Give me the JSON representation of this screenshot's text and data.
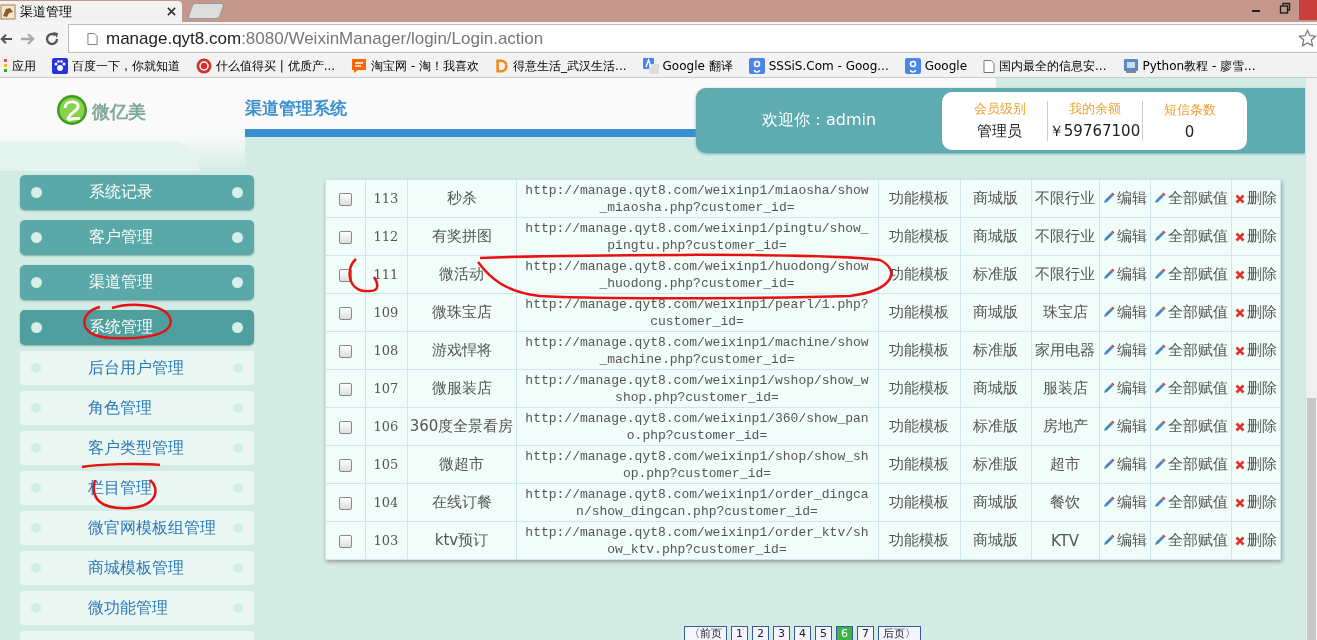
{
  "browser": {
    "tab_title": "渠道管理",
    "url_host": "manage.qyt8.com",
    "url_rest": ":8080/WeixinManager/login/Login.action",
    "bookmarks": [
      {
        "label": "应用",
        "kind": "apps"
      },
      {
        "label": "百度一下，你就知道",
        "kind": "paw"
      },
      {
        "label": "什么值得买 | 优质产...",
        "kind": "seal"
      },
      {
        "label": "淘宝网 - 淘！我喜欢",
        "kind": "taobao"
      },
      {
        "label": "得意生活_武汉生活...",
        "kind": "letter"
      },
      {
        "label": "Google 翻译",
        "kind": "translate"
      },
      {
        "label": "SSSiS.Com - Goog...",
        "kind": "google"
      },
      {
        "label": "Google",
        "kind": "google"
      },
      {
        "label": "国内最全的信息安...",
        "kind": "page"
      },
      {
        "label": "Python教程 - 廖雪...",
        "kind": "mac"
      }
    ]
  },
  "header": {
    "logo_text": "微亿美",
    "title": "渠道管理系统",
    "welcome": "欢迎你：admin",
    "stats": [
      {
        "label": "会员级别",
        "value": "管理员"
      },
      {
        "label": "我的余额",
        "value": "￥59767100"
      },
      {
        "label": "短信条数",
        "value": "0"
      }
    ]
  },
  "sidebar": {
    "items": [
      {
        "label": "系统记录"
      },
      {
        "label": "客户管理"
      },
      {
        "label": "渠道管理"
      },
      {
        "label": "系统管理",
        "children": [
          {
            "label": "后台用户管理"
          },
          {
            "label": "角色管理"
          },
          {
            "label": "客户类型管理"
          },
          {
            "label": "栏目管理"
          },
          {
            "label": "微官网模板组管理"
          },
          {
            "label": "商城模板管理"
          },
          {
            "label": "微功能管理"
          }
        ]
      }
    ]
  },
  "table": {
    "rows": [
      {
        "checked": false,
        "id": "113",
        "name": "秒杀",
        "url": "http://manage.qyt8.com/weixinp1/miaosha/show_miaosha.php?customer_id=",
        "type": "功能模板",
        "edition": "商城版",
        "industry": "不限行业",
        "edit": "编辑",
        "assign": "全部赋值",
        "delete": "删除"
      },
      {
        "checked": false,
        "id": "112",
        "name": "有奖拼图",
        "url": "http://manage.qyt8.com/weixinp1/pingtu/show_pingtu.php?customer_id=",
        "type": "功能模板",
        "edition": "商城版",
        "industry": "不限行业",
        "edit": "编辑",
        "assign": "全部赋值",
        "delete": "删除"
      },
      {
        "checked": false,
        "id": "111",
        "name": "微活动",
        "url": "http://manage.qyt8.com/weixinp1/huodong/show_huodong.php?customer_id=",
        "type": "功能模板",
        "edition": "标准版",
        "industry": "不限行业",
        "edit": "编辑",
        "assign": "全部赋值",
        "delete": "删除"
      },
      {
        "checked": false,
        "id": "109",
        "name": "微珠宝店",
        "url": "http://manage.qyt8.com/weixinp1/pearl/1.php?customer_id=",
        "type": "功能模板",
        "edition": "商城版",
        "industry": "珠宝店",
        "edit": "编辑",
        "assign": "全部赋值",
        "delete": "删除"
      },
      {
        "checked": false,
        "id": "108",
        "name": "游戏悍将",
        "url": "http://manage.qyt8.com/weixinp1/machine/show_machine.php?customer_id=",
        "type": "功能模板",
        "edition": "标准版",
        "industry": "家用电器",
        "edit": "编辑",
        "assign": "全部赋值",
        "delete": "删除"
      },
      {
        "checked": false,
        "id": "107",
        "name": "微服装店",
        "url": "http://manage.qyt8.com/weixinp1/wshop/show_wshop.php?customer_id=",
        "type": "功能模板",
        "edition": "商城版",
        "industry": "服装店",
        "edit": "编辑",
        "assign": "全部赋值",
        "delete": "删除"
      },
      {
        "checked": false,
        "id": "106",
        "name": "360度全景看房",
        "url": "http://manage.qyt8.com/weixinp1/360/show_pano.php?customer_id=",
        "type": "功能模板",
        "edition": "标准版",
        "industry": "房地产",
        "edit": "编辑",
        "assign": "全部赋值",
        "delete": "删除"
      },
      {
        "checked": false,
        "id": "105",
        "name": "微超市",
        "url": "http://manage.qyt8.com/weixinp1/shop/show_shop.php?customer_id=",
        "type": "功能模板",
        "edition": "标准版",
        "industry": "超市",
        "edit": "编辑",
        "assign": "全部赋值",
        "delete": "删除"
      },
      {
        "checked": false,
        "id": "104",
        "name": "在线订餐",
        "url": "http://manage.qyt8.com/weixinp1/order_dingcan/show_dingcan.php?customer_id=",
        "type": "功能模板",
        "edition": "商城版",
        "industry": "餐饮",
        "edit": "编辑",
        "assign": "全部赋值",
        "delete": "删除"
      },
      {
        "checked": false,
        "id": "103",
        "name": "ktv预订",
        "url": "http://manage.qyt8.com/weixinp1/order_ktv/show_ktv.php?customer_id=",
        "type": "功能模板",
        "edition": "商城版",
        "industry": "KTV",
        "edit": "编辑",
        "assign": "全部赋值",
        "delete": "删除"
      }
    ]
  },
  "pagination": [
    {
      "label": "〈前页",
      "selected": false
    },
    {
      "label": "1",
      "selected": false
    },
    {
      "label": "2",
      "selected": false
    },
    {
      "label": "3",
      "selected": false
    },
    {
      "label": "4",
      "selected": false
    },
    {
      "label": "5",
      "selected": false
    },
    {
      "label": "6",
      "selected": true
    },
    {
      "label": "7",
      "selected": false
    },
    {
      "label": "后页〉",
      "selected": false
    }
  ]
}
